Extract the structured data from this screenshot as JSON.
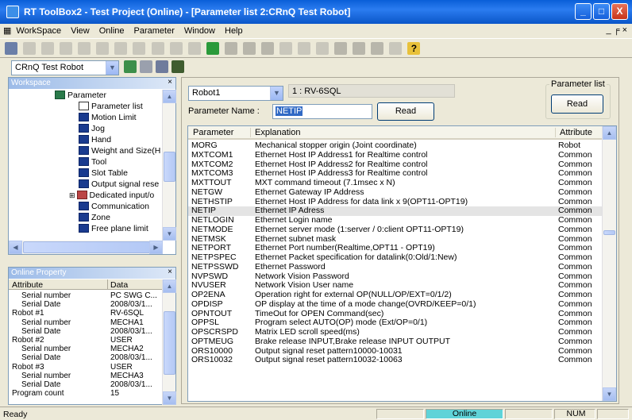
{
  "window": {
    "title": "RT ToolBox2 - Test Project  (Online) - [Parameter list 2:CRnQ Test Robot]",
    "controls": [
      "_",
      "□",
      "X"
    ]
  },
  "menu": [
    "WorkSpace",
    "View",
    "Online",
    "Parameter",
    "Window",
    "Help"
  ],
  "mdi_controls": "_ ╒ ×",
  "robot_selector": {
    "value": "CRnQ Test Robot"
  },
  "workspace": {
    "title": "Workspace",
    "close": "×",
    "items": [
      {
        "label": "Parameter",
        "level": 0
      },
      {
        "label": "Parameter list",
        "level": 1
      },
      {
        "label": "Motion Limit",
        "level": 1
      },
      {
        "label": "Jog",
        "level": 1
      },
      {
        "label": "Hand",
        "level": 1
      },
      {
        "label": "Weight and Size(H",
        "level": 1
      },
      {
        "label": "Tool",
        "level": 1
      },
      {
        "label": "Slot Table",
        "level": 1
      },
      {
        "label": "Output signal rese",
        "level": 1
      },
      {
        "label": "Dedicated input/o",
        "level": 1
      },
      {
        "label": "Communication",
        "level": 1
      },
      {
        "label": "Zone",
        "level": 1
      },
      {
        "label": "Free plane limit",
        "level": 1
      }
    ]
  },
  "online_property": {
    "title": "Online Property",
    "close": "×",
    "headers": [
      "Attribute",
      "Data"
    ],
    "rows": [
      [
        "Serial number",
        "PC SWG C..."
      ],
      [
        "Serial Date",
        "2008/03/1..."
      ],
      [
        "Robot #1",
        "RV-6SQL"
      ],
      [
        "Serial number",
        "MECHA1"
      ],
      [
        "Serial Date",
        "2008/03/1..."
      ],
      [
        "Robot #2",
        "USER"
      ],
      [
        "Serial number",
        "MECHA2"
      ],
      [
        "Serial Date",
        "2008/03/1..."
      ],
      [
        "Robot #3",
        "USER"
      ],
      [
        "Serial number",
        "MECHA3"
      ],
      [
        "Serial Date",
        "2008/03/1..."
      ],
      [
        "Program count",
        "15"
      ]
    ]
  },
  "param_panel": {
    "robot_select": "Robot1",
    "robot_model": "1 : RV-6SQL",
    "param_name_label": "Parameter Name :",
    "param_name_value": "NETIP",
    "read_label": "Read",
    "group_label": "Parameter list",
    "group_read_label": "Read",
    "headers": [
      "Parameter",
      "Explanation",
      "Attribute"
    ],
    "rows": [
      [
        "MORG",
        "Mechanical stopper origin (Joint coordinate)",
        "Robot"
      ],
      [
        "MXTCOM1",
        "Ethernet Host IP Address1 for Realtime control",
        "Common"
      ],
      [
        "MXTCOM2",
        "Ethernet Host IP Address2 for Realtime control",
        "Common"
      ],
      [
        "MXTCOM3",
        "Ethernet Host IP Address3 for Realtime control",
        "Common"
      ],
      [
        "MXTTOUT",
        "MXT command timeout (7.1msec x N)",
        "Common"
      ],
      [
        "NETGW",
        "Ethernet Gateway IP Address",
        "Common"
      ],
      [
        "NETHSTIP",
        "Ethernet Host IP Address for data link x 9(OPT11-OPT19)",
        "Common"
      ],
      [
        "NETIP",
        "Ethernet IP Adress",
        "Common"
      ],
      [
        "NETLOGIN",
        "Ethernet Login name",
        "Common"
      ],
      [
        "NETMODE",
        "Ethernet server mode (1:server / 0:client OPT11-OPT19)",
        "Common"
      ],
      [
        "NETMSK",
        "Ethernet subnet mask",
        "Common"
      ],
      [
        "NETPORT",
        "Ethernet Port number(Realtime,OPT11 - OPT19)",
        "Common"
      ],
      [
        "NETPSPEC",
        "Ethernet Packet specification for datalink(0:Old/1:New)",
        "Common"
      ],
      [
        "NETPSSWD",
        "Ethernet Password",
        "Common"
      ],
      [
        "NVPSWD",
        "Network Vision Password",
        "Common"
      ],
      [
        "NVUSER",
        "Network Vision User name",
        "Common"
      ],
      [
        "OP2ENA",
        "Operation right for external OP(NULL/OP/EXT=0/1/2)",
        "Common"
      ],
      [
        "OPDISP",
        "OP display at the time of a mode change(OVRD/KEEP=0/1)",
        "Common"
      ],
      [
        "OPNTOUT",
        "TimeOut for OPEN Command(sec)",
        "Common"
      ],
      [
        "OPPSL",
        "Program select AUTO(OP) mode (Ext/OP=0/1)",
        "Common"
      ],
      [
        "OPSCRSPD",
        "Matrix LED scroll speed(ms)",
        "Common"
      ],
      [
        "OPTMEUG",
        "Brake release INPUT,Brake release INPUT OUTPUT",
        "Common"
      ],
      [
        "ORS10000",
        "Output signal reset pattern10000-10031",
        "Common"
      ],
      [
        "ORS10032",
        "Output signal reset pattern10032-10063",
        "Common"
      ]
    ],
    "selected": "NETIP"
  },
  "status": {
    "ready": "Ready",
    "online": "Online",
    "num": "NUM"
  },
  "colors": {
    "titlebar": "#0a5fd8",
    "online_pane": "#5fd3d8",
    "selected_row": "#e4e4e4"
  }
}
